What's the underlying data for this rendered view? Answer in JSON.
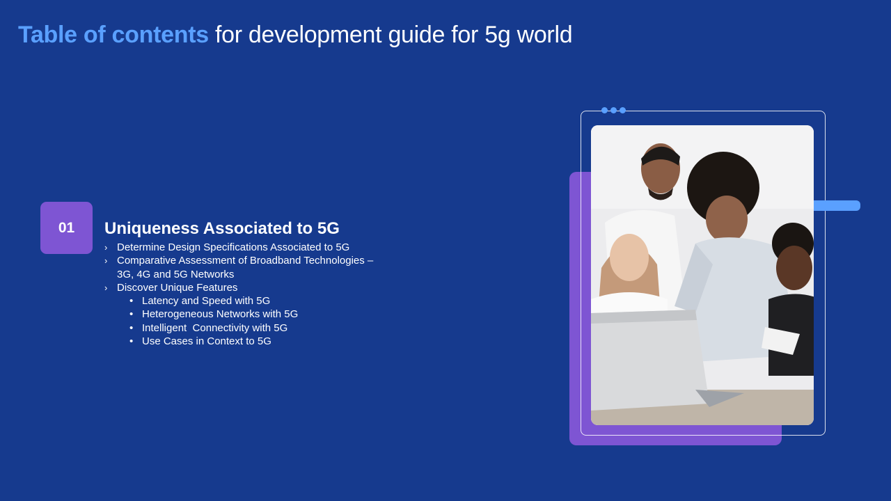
{
  "header": {
    "title_highlight": "Table of contents",
    "title_rest": " for development guide for 5g world"
  },
  "section": {
    "number": "01",
    "title": "Uniqueness Associated to 5G",
    "items": [
      {
        "label": "Determine Design Specifications Associated to 5G"
      },
      {
        "label": "Comparative Assessment of Broadband Technologies –\n3G, 4G and 5G Networks"
      },
      {
        "label": "Discover Unique Features"
      }
    ],
    "subitems": [
      {
        "label": "Latency and Speed with 5G"
      },
      {
        "label": "Heterogeneous Networks with 5G"
      },
      {
        "label": "Intelligent  Connectivity with 5G"
      },
      {
        "label": "Use Cases in Context to 5G"
      }
    ]
  },
  "colors": {
    "background": "#163a8e",
    "accent_blue": "#5aa0ff",
    "accent_purple": "#7e55d3",
    "text": "#ffffff"
  }
}
